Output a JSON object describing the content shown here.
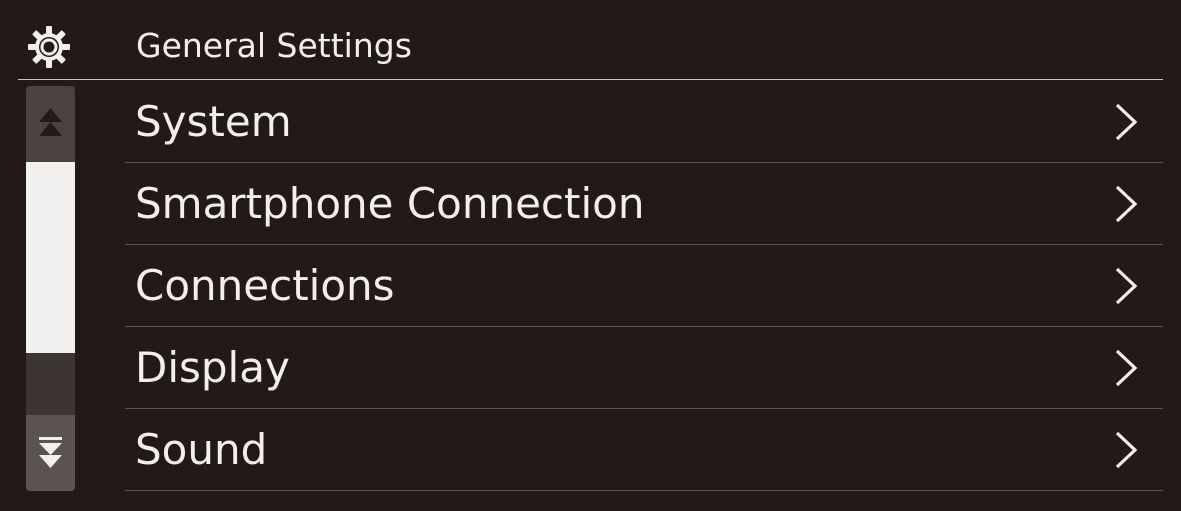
{
  "header": {
    "icon": "gear-icon",
    "title": "General Settings"
  },
  "scrollbar": {
    "up_icon": "scroll-up-icon",
    "down_icon": "scroll-down-icon"
  },
  "menu": {
    "items": [
      {
        "label": "System",
        "icon": "chevron-right-icon"
      },
      {
        "label": "Smartphone Connection",
        "icon": "chevron-right-icon"
      },
      {
        "label": "Connections",
        "icon": "chevron-right-icon"
      },
      {
        "label": "Display",
        "icon": "chevron-right-icon"
      },
      {
        "label": "Sound",
        "icon": "chevron-right-icon"
      }
    ]
  },
  "colors": {
    "background": "#231a18",
    "text": "#f2f0ee",
    "divider": "#5a524f",
    "scroll_thumb": "#f2f0ee"
  }
}
